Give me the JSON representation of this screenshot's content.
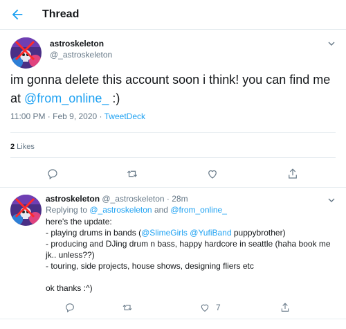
{
  "header": {
    "title": "Thread"
  },
  "tweet1": {
    "name": "astroskeleton",
    "handle": "@_astroskeleton",
    "text_before": "im gonna delete this account soon i think! you can find me at ",
    "mention": "@from_online_",
    "text_after": "  :)",
    "time": "11:00 PM · Feb 9, 2020 · ",
    "source": "TweetDeck",
    "likes_count": "2",
    "likes_label": " Likes"
  },
  "tweet2": {
    "name": "astroskeleton",
    "handle_time": " @_astroskeleton · 28m",
    "replying_prefix": "Replying to ",
    "replying_user1": "@_astroskeleton",
    "replying_and": " and ",
    "replying_user2": "@from_online_",
    "line1": "here's the update:",
    "line2_before": "- playing drums in bands (",
    "line2_m1": "@SlimeGirls",
    "line2_space": " ",
    "line2_m2": "@YufiBand",
    "line2_after": " puppybrother)",
    "line3": "- producing and DJing drum n bass, happy hardcore in seattle (haha book me jk.. unless??)",
    "line4": "- touring, side projects, house shows, designing fliers etc",
    "line5": "ok thanks :^)",
    "like_count": "7"
  },
  "colors": {
    "accent": "#1da1f2",
    "muted": "#657786",
    "text": "#14171a",
    "border": "#e6ecf0"
  },
  "icons": [
    "back-arrow-icon",
    "chevron-down-icon",
    "reply-icon",
    "retweet-icon",
    "like-icon",
    "share-icon"
  ]
}
